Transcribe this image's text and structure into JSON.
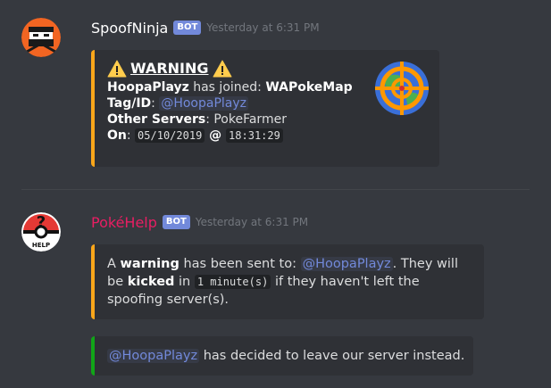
{
  "messages": [
    {
      "username": "SpoofNinja",
      "username_color": "#ffffff",
      "bot_tag": "BOT",
      "timestamp": "Yesterday at 6:31 PM",
      "embed": {
        "border_color": "#faa61a",
        "title_icon": "warning-icon",
        "title": "WARNING",
        "line1_user": "HoopaPlayz",
        "line1_mid": " has joined: ",
        "line1_server": "WAPokeMap",
        "tag_label": "Tag/ID",
        "tag_mention": "@HoopaPlayz",
        "other_label": "Other Servers",
        "other_value": ": PokeFarmer",
        "on_label": "On",
        "on_colon": ": ",
        "on_date": "05/10/2019",
        "on_at": " @ ",
        "on_time": "18:31:29",
        "thumbnail": "crosshair-globe-icon"
      }
    },
    {
      "username": "PokéHelp",
      "username_color": "#e91e63",
      "bot_tag": "BOT",
      "timestamp": "Yesterday at 6:31 PM",
      "embed1": {
        "border_color": "#faa61a",
        "p1": "A ",
        "warning_word": "warning",
        "p2": " has been sent to: ",
        "mention": "@HoopaPlayz",
        "p3": ". They will be ",
        "kicked_word": "kicked",
        "p4": " in ",
        "code": "1 minute(s)",
        "p5": " if they haven't left the spoofing server(s)."
      },
      "embed2": {
        "border_color": "#11a518",
        "mention": "@HoopaPlayz",
        "text": " has decided to leave our server instead."
      }
    }
  ]
}
